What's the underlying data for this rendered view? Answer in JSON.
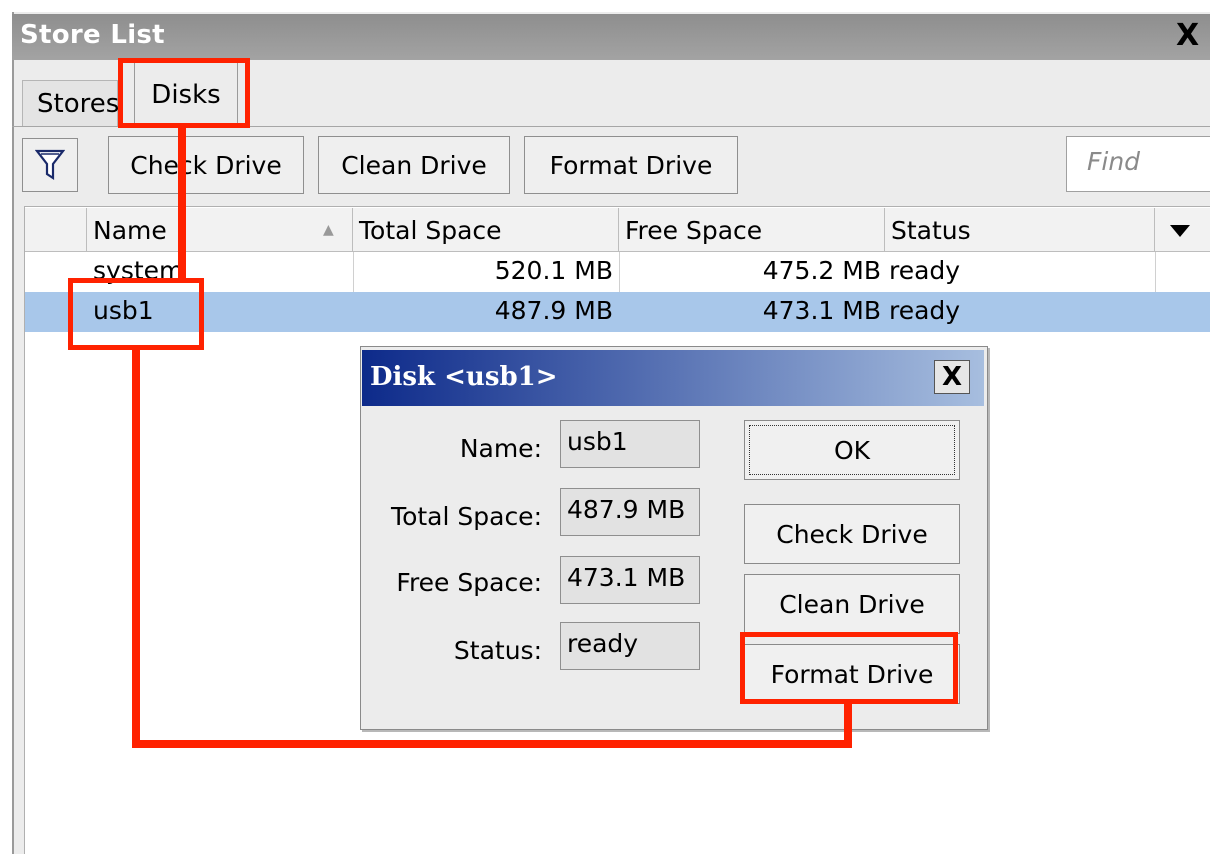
{
  "window": {
    "title": "Store List",
    "close_label": "X"
  },
  "tabs": [
    {
      "label": "Stores"
    },
    {
      "label": "Disks"
    }
  ],
  "toolbar": {
    "filter_icon": "filter-funnel-icon",
    "check_label": "Check Drive",
    "clean_label": "Clean Drive",
    "format_label": "Format Drive",
    "find_placeholder": "Find"
  },
  "table": {
    "columns": [
      "Name",
      "Total Space",
      "Free Space",
      "Status"
    ],
    "sort_indicator": "▲",
    "rows": [
      {
        "name": "system",
        "total": "520.1 MB",
        "free": "475.2 MB",
        "status": "ready"
      },
      {
        "name": "usb1",
        "total": "487.9 MB",
        "free": "473.1 MB",
        "status": "ready"
      }
    ],
    "selected_row": "usb1"
  },
  "dialog": {
    "title": "Disk <usb1>",
    "close_label": "X",
    "fields": [
      {
        "label": "Name:",
        "value": "usb1"
      },
      {
        "label": "Total Space:",
        "value": "487.9 MB"
      },
      {
        "label": "Free Space:",
        "value": "473.1 MB"
      },
      {
        "label": "Status:",
        "value": "ready"
      }
    ],
    "buttons": {
      "ok": "OK",
      "check": "Check Drive",
      "clean": "Clean Drive",
      "format": "Format Drive"
    }
  },
  "colors": {
    "selection": "#a8c7ea",
    "annotation": "#ff2200",
    "dialog_title": "#0d2a8a"
  }
}
